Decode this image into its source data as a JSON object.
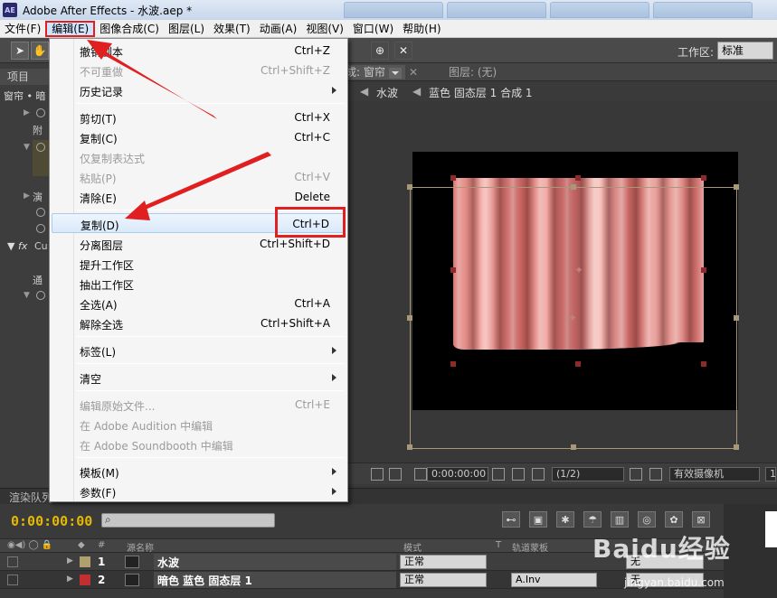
{
  "window": {
    "title": "Adobe After Effects - 水波.aep *",
    "app_icon": "AE"
  },
  "menubar": [
    {
      "label": "文件(F)"
    },
    {
      "label": "编辑(E)"
    },
    {
      "label": "图像合成(C)"
    },
    {
      "label": "图层(L)"
    },
    {
      "label": "效果(T)"
    },
    {
      "label": "动画(A)"
    },
    {
      "label": "视图(V)"
    },
    {
      "label": "窗口(W)"
    },
    {
      "label": "帮助(H)"
    }
  ],
  "toolbar": {
    "workspace_label": "工作区:",
    "workspace_value": "标准"
  },
  "left_panel": {
    "tab": "项目",
    "subtitle": "窗帘 • 暗",
    "rows": [
      "附",
      "演",
      "通",
      "Cu"
    ]
  },
  "viewer": {
    "tab_comp": "合成: 窗帘",
    "tab_layer": "图层: (无)",
    "crumbs": [
      "水波",
      "蓝色 固态层 1 合成 1"
    ],
    "bottom": {
      "timecode": "0:00:00:00",
      "resolution": "(1/2)",
      "camera": "有效摄像机",
      "views": "1"
    }
  },
  "edit_menu": {
    "items": [
      {
        "label": "撤销副本",
        "shortcut": "Ctrl+Z",
        "enabled": true
      },
      {
        "label": "不可重做",
        "shortcut": "Ctrl+Shift+Z",
        "enabled": false
      },
      {
        "label": "历史记录",
        "shortcut": "",
        "enabled": true,
        "submenu": true
      },
      {
        "label": "剪切(T)",
        "shortcut": "Ctrl+X",
        "enabled": true
      },
      {
        "label": "复制(C)",
        "shortcut": "Ctrl+C",
        "enabled": true
      },
      {
        "label": "仅复制表达式",
        "shortcut": "",
        "enabled": false
      },
      {
        "label": "粘贴(P)",
        "shortcut": "Ctrl+V",
        "enabled": false
      },
      {
        "label": "清除(E)",
        "shortcut": "Delete",
        "enabled": true
      },
      {
        "label": "复制(D)",
        "shortcut": "Ctrl+D",
        "enabled": true,
        "highlighted": true
      },
      {
        "label": "分离图层",
        "shortcut": "Ctrl+Shift+D",
        "enabled": true
      },
      {
        "label": "提升工作区",
        "shortcut": "",
        "enabled": true
      },
      {
        "label": "抽出工作区",
        "shortcut": "",
        "enabled": true
      },
      {
        "label": "全选(A)",
        "shortcut": "Ctrl+A",
        "enabled": true
      },
      {
        "label": "解除全选",
        "shortcut": "Ctrl+Shift+A",
        "enabled": true
      },
      {
        "label": "标签(L)",
        "shortcut": "",
        "enabled": true,
        "submenu": true
      },
      {
        "label": "清空",
        "shortcut": "",
        "enabled": true,
        "submenu": true
      },
      {
        "label": "编辑原始文件...",
        "shortcut": "Ctrl+E",
        "enabled": false
      },
      {
        "label": "在 Adobe Audition 中编辑",
        "shortcut": "",
        "enabled": false
      },
      {
        "label": "在 Adobe Soundbooth 中编辑",
        "shortcut": "",
        "enabled": false
      },
      {
        "label": "模板(M)",
        "shortcut": "",
        "enabled": true,
        "submenu": true
      },
      {
        "label": "参数(F)",
        "shortcut": "",
        "enabled": true,
        "submenu": true
      }
    ]
  },
  "render_queue_tab": "渲染队列",
  "timeline": {
    "timecode": "0:00:00:00",
    "headers": {
      "num": "#",
      "source_name": "源名称",
      "mode": "模式",
      "t": "T",
      "track_matte": "轨道蒙板"
    },
    "layers": [
      {
        "num": "1",
        "name": "水波",
        "mode": "正常",
        "track": "",
        "parent": "无",
        "label_color": "#b0a070"
      },
      {
        "num": "2",
        "name": "暗色 蓝色 固态层 1",
        "mode": "正常",
        "track": "A.Inv",
        "parent": "无",
        "label_color": "#c03030"
      }
    ]
  },
  "watermark": {
    "text": "Baidu经验",
    "url": "jingyan.baidu.com"
  },
  "colors": {
    "timecode": "#e6b800",
    "annotation_red": "#e02020"
  }
}
